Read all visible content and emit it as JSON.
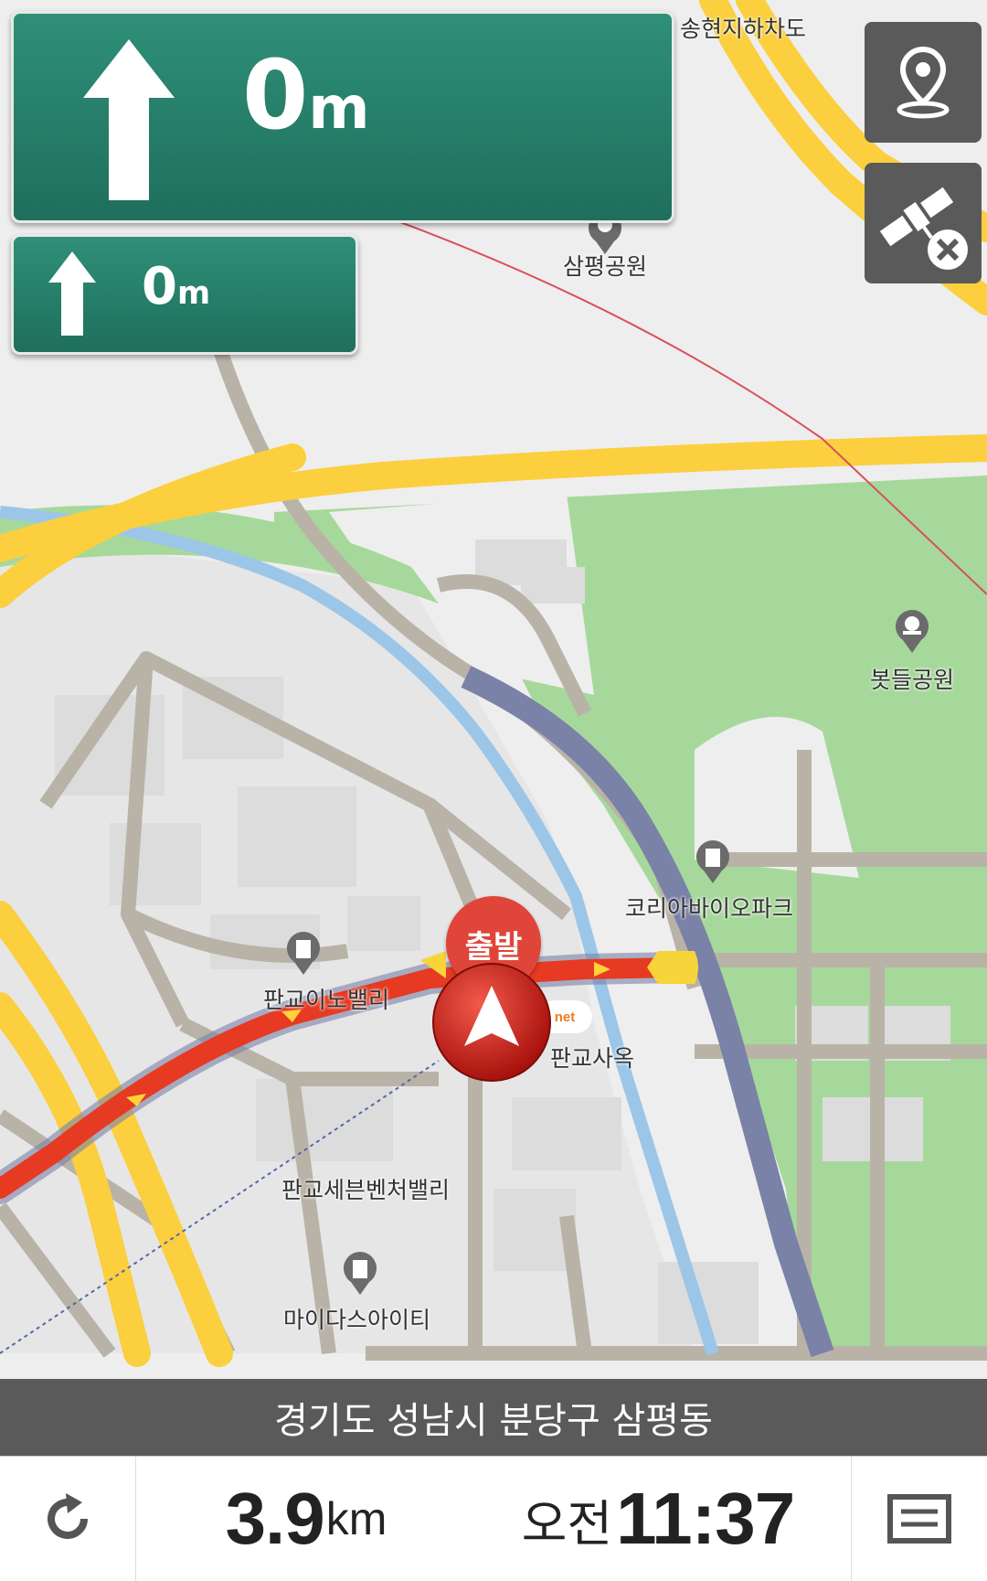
{
  "colors": {
    "background": "#eeeeee",
    "park": "#a7d89b",
    "highway": "#fbcf3e",
    "road": "#b9b3a7",
    "river": "#9cc6e8",
    "expressway": "#7a82a8",
    "route": "#e63a22",
    "sign_green": "#257a66",
    "button_gray": "#5a5a5a"
  },
  "guidance": {
    "main": {
      "icon": "arrow-up-icon",
      "distance_value": "0",
      "distance_unit": "m"
    },
    "next": {
      "icon": "arrow-up-icon",
      "distance_value": "0",
      "distance_unit": "m"
    }
  },
  "buttons": {
    "location": {
      "icon": "location-pin-icon"
    },
    "gps": {
      "icon": "satellite-off-icon"
    }
  },
  "map": {
    "labels": {
      "songhyeon_underpass": "송현지하차도",
      "sampyeong_park": "삼평공원",
      "bosdeul_park": "봇들공원",
      "korea_biopark": "코리아바이오파크",
      "pangyo_innovalley": "판교이노밸리",
      "pangyo_office": "판교사옥",
      "pangyo_seven_venture": "판교세븐벤처밸리",
      "mydas_it": "마이다스아이티"
    },
    "depart_label": "출발",
    "logo_text": "net"
  },
  "region": {
    "address": "경기도 성남시 분당구 삼평동"
  },
  "bottom": {
    "distance_value": "3.9",
    "distance_unit": "km",
    "time_ampm": "오전",
    "time_value": "11:37",
    "refresh_icon": "refresh-icon",
    "menu_icon": "menu-icon"
  }
}
